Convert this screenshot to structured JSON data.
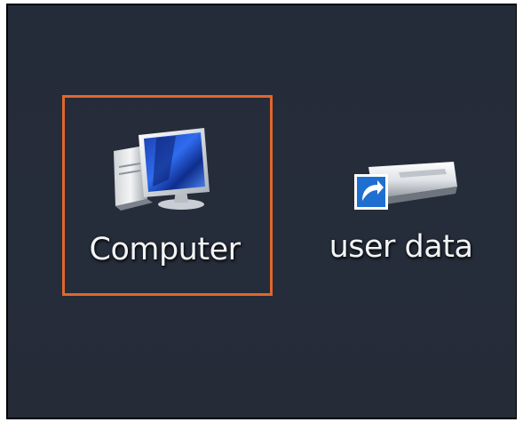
{
  "desktop": {
    "icons": [
      {
        "label": "Computer",
        "icon": "computer-icon",
        "selected": true
      },
      {
        "label": "user data",
        "icon": "drive-shortcut-icon",
        "selected": false
      }
    ],
    "selection_color": "#e0672c",
    "background_color": "#262d3a"
  }
}
